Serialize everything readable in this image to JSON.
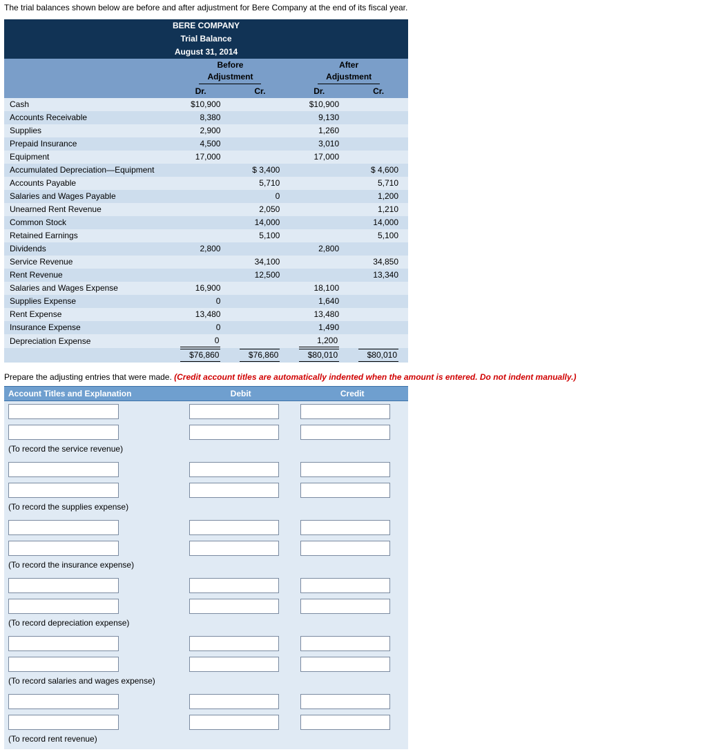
{
  "intro": "The trial balances shown below are before and after adjustment for Bere Company at the end of its fiscal year.",
  "header": {
    "company": "BERE COMPANY",
    "report": "Trial Balance",
    "date": "August 31, 2014",
    "before": "Before",
    "after": "After",
    "adjustment": "Adjustment",
    "dr": "Dr.",
    "cr": "Cr."
  },
  "rows": [
    {
      "acct": "Cash",
      "bdr": "$10,900",
      "bcr": "",
      "adr": "$10,900",
      "acr": ""
    },
    {
      "acct": "Accounts Receivable",
      "bdr": "8,380",
      "bcr": "",
      "adr": "9,130",
      "acr": ""
    },
    {
      "acct": "Supplies",
      "bdr": "2,900",
      "bcr": "",
      "adr": "1,260",
      "acr": ""
    },
    {
      "acct": "Prepaid Insurance",
      "bdr": "4,500",
      "bcr": "",
      "adr": "3,010",
      "acr": ""
    },
    {
      "acct": "Equipment",
      "bdr": "17,000",
      "bcr": "",
      "adr": "17,000",
      "acr": ""
    },
    {
      "acct": "Accumulated Depreciation—Equipment",
      "bdr": "",
      "bcr": "$ 3,400",
      "adr": "",
      "acr": "$ 4,600"
    },
    {
      "acct": "Accounts Payable",
      "bdr": "",
      "bcr": "5,710",
      "adr": "",
      "acr": "5,710"
    },
    {
      "acct": "Salaries and Wages Payable",
      "bdr": "",
      "bcr": "0",
      "adr": "",
      "acr": "1,200"
    },
    {
      "acct": "Unearned Rent Revenue",
      "bdr": "",
      "bcr": "2,050",
      "adr": "",
      "acr": "1,210"
    },
    {
      "acct": "Common Stock",
      "bdr": "",
      "bcr": "14,000",
      "adr": "",
      "acr": "14,000"
    },
    {
      "acct": "Retained Earnings",
      "bdr": "",
      "bcr": "5,100",
      "adr": "",
      "acr": "5,100"
    },
    {
      "acct": "Dividends",
      "bdr": "2,800",
      "bcr": "",
      "adr": "2,800",
      "acr": ""
    },
    {
      "acct": "Service Revenue",
      "bdr": "",
      "bcr": "34,100",
      "adr": "",
      "acr": "34,850"
    },
    {
      "acct": "Rent Revenue",
      "bdr": "",
      "bcr": "12,500",
      "adr": "",
      "acr": "13,340"
    },
    {
      "acct": "Salaries and Wages Expense",
      "bdr": "16,900",
      "bcr": "",
      "adr": "18,100",
      "acr": ""
    },
    {
      "acct": "Supplies Expense",
      "bdr": "0",
      "bcr": "",
      "adr": "1,640",
      "acr": ""
    },
    {
      "acct": "Rent Expense",
      "bdr": "13,480",
      "bcr": "",
      "adr": "13,480",
      "acr": ""
    },
    {
      "acct": "Insurance Expense",
      "bdr": "0",
      "bcr": "",
      "adr": "1,490",
      "acr": ""
    },
    {
      "acct": "Depreciation Expense",
      "bdr": "0",
      "bcr": "",
      "adr": "1,200",
      "acr": ""
    }
  ],
  "totals": {
    "bdr": "$76,860",
    "bcr": "$76,860",
    "adr": "$80,010",
    "acr": "$80,010"
  },
  "instruct": {
    "plain": "Prepare the adjusting entries that were made. ",
    "red": "(Credit account titles are automatically indented when the amount is entered. Do not indent manually.)"
  },
  "entries_header": {
    "acct": "Account Titles and Explanation",
    "debit": "Debit",
    "credit": "Credit"
  },
  "entry_notes": [
    "(To record the service revenue)",
    "(To record the supplies expense)",
    "(To record the insurance expense)",
    "(To record depreciation expense)",
    "(To record salaries and wages expense)",
    "(To record rent revenue)"
  ],
  "chart_data": {
    "type": "table",
    "title": "BERE COMPANY Trial Balance August 31, 2014",
    "columns": [
      "Account",
      "Before Adj. Dr.",
      "Before Adj. Cr.",
      "After Adj. Dr.",
      "After Adj. Cr."
    ],
    "data": [
      [
        "Cash",
        10900,
        null,
        10900,
        null
      ],
      [
        "Accounts Receivable",
        8380,
        null,
        9130,
        null
      ],
      [
        "Supplies",
        2900,
        null,
        1260,
        null
      ],
      [
        "Prepaid Insurance",
        4500,
        null,
        3010,
        null
      ],
      [
        "Equipment",
        17000,
        null,
        17000,
        null
      ],
      [
        "Accumulated Depreciation—Equipment",
        null,
        3400,
        null,
        4600
      ],
      [
        "Accounts Payable",
        null,
        5710,
        null,
        5710
      ],
      [
        "Salaries and Wages Payable",
        null,
        0,
        null,
        1200
      ],
      [
        "Unearned Rent Revenue",
        null,
        2050,
        null,
        1210
      ],
      [
        "Common Stock",
        null,
        14000,
        null,
        14000
      ],
      [
        "Retained Earnings",
        null,
        5100,
        null,
        5100
      ],
      [
        "Dividends",
        2800,
        null,
        2800,
        null
      ],
      [
        "Service Revenue",
        null,
        34100,
        null,
        34850
      ],
      [
        "Rent Revenue",
        null,
        12500,
        null,
        13340
      ],
      [
        "Salaries and Wages Expense",
        16900,
        null,
        18100,
        null
      ],
      [
        "Supplies Expense",
        0,
        null,
        1640,
        null
      ],
      [
        "Rent Expense",
        13480,
        null,
        13480,
        null
      ],
      [
        "Insurance Expense",
        0,
        null,
        1490,
        null
      ],
      [
        "Depreciation Expense",
        0,
        null,
        1200,
        null
      ]
    ],
    "totals": [
      76860,
      76860,
      80010,
      80010
    ]
  }
}
